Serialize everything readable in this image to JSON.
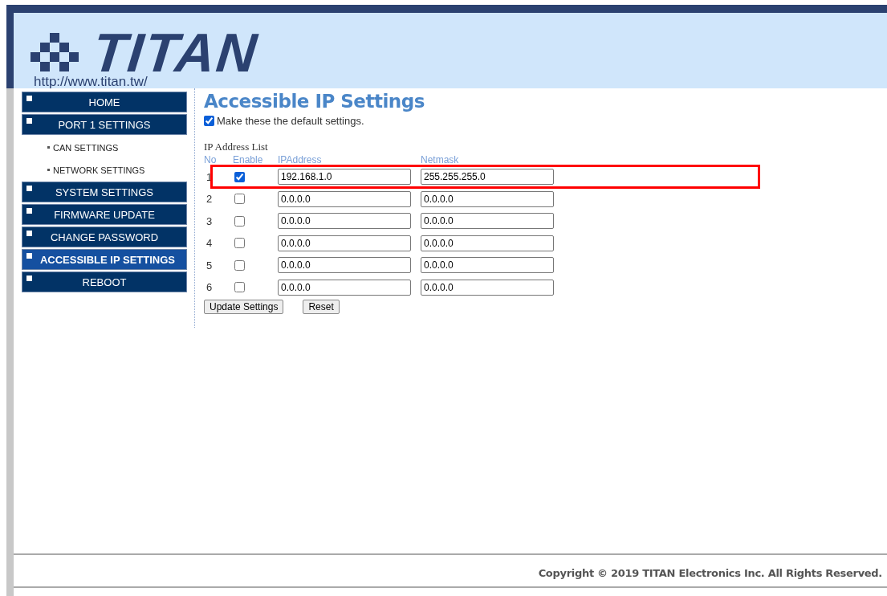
{
  "header": {
    "logo_text": "TITAN",
    "url": "http://www.titan.tw/"
  },
  "sidebar": {
    "items": [
      {
        "label": "HOME",
        "kind": "button",
        "selected": false
      },
      {
        "label": "PORT 1 SETTINGS",
        "kind": "button",
        "selected": false
      },
      {
        "label": "CAN SETTINGS",
        "kind": "sublink",
        "selected": false
      },
      {
        "label": "NETWORK SETTINGS",
        "kind": "sublink",
        "selected": false
      },
      {
        "label": "SYSTEM SETTINGS",
        "kind": "button",
        "selected": false
      },
      {
        "label": "FIRMWARE UPDATE",
        "kind": "button",
        "selected": false
      },
      {
        "label": "CHANGE PASSWORD",
        "kind": "button",
        "selected": false
      },
      {
        "label": "ACCESSIBLE IP SETTINGS",
        "kind": "button",
        "selected": true
      },
      {
        "label": "REBOOT",
        "kind": "button",
        "selected": false
      }
    ]
  },
  "main": {
    "title": "Accessible IP Settings",
    "default_option": {
      "label": "Make these the default settings.",
      "checked": true
    },
    "list_title": "IP Address List",
    "columns": [
      "No",
      "Enable",
      "IPAddress",
      "Netmask"
    ],
    "rows": [
      {
        "no": "1",
        "enabled": true,
        "ip": "192.168.1.0",
        "netmask": "255.255.255.0",
        "highlighted": true
      },
      {
        "no": "2",
        "enabled": false,
        "ip": "0.0.0.0",
        "netmask": "0.0.0.0",
        "highlighted": false
      },
      {
        "no": "3",
        "enabled": false,
        "ip": "0.0.0.0",
        "netmask": "0.0.0.0",
        "highlighted": false
      },
      {
        "no": "4",
        "enabled": false,
        "ip": "0.0.0.0",
        "netmask": "0.0.0.0",
        "highlighted": false
      },
      {
        "no": "5",
        "enabled": false,
        "ip": "0.0.0.0",
        "netmask": "0.0.0.0",
        "highlighted": false
      },
      {
        "no": "6",
        "enabled": false,
        "ip": "0.0.0.0",
        "netmask": "0.0.0.0",
        "highlighted": false
      }
    ],
    "buttons": [
      "Update Settings",
      "Reset"
    ]
  },
  "footer": {
    "copyright": "Copyright © 2019 TITAN Electronics Inc. All Rights Reserved."
  }
}
